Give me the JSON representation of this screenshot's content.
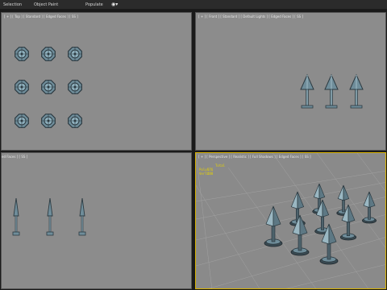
{
  "menubar": {
    "items": [
      "Selection",
      "Object Paint",
      "Populate"
    ],
    "eye_icon": "eye-icon"
  },
  "viewports": {
    "top": {
      "label": "[ + ] [ Top ] [ Standard ] [ Edged Faces ] [ SS ]"
    },
    "front": {
      "label": "[ + ] [ Front ] [ Standard ] [ Default Lights ] [ Edged Faces ] [ SS ]"
    },
    "left": {
      "label": "ed Faces ] [ SS ]"
    },
    "perspective": {
      "label": "[ + ] [ Perspective ] [ Realistic ] [ Full Shadows ] [ Edged Faces ] [ SS ]",
      "stats": {
        "header": "Total",
        "rows": [
          {
            "label": "Polys:",
            "value": "576"
          },
          {
            "label": "Verts:",
            "value": "288"
          }
        ]
      }
    }
  },
  "colors": {
    "viewport_bg": "#8c8c8c",
    "active_border": "#d9b200",
    "object_fill": "#6f8d9a",
    "object_dark": "#2c3a41",
    "stats_text": "#e6d200"
  }
}
